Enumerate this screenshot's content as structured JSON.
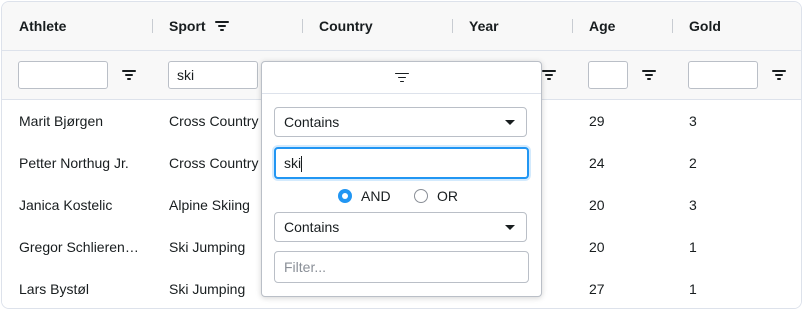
{
  "columns": [
    {
      "label": "Athlete"
    },
    {
      "label": "Sport"
    },
    {
      "label": "Country"
    },
    {
      "label": "Year"
    },
    {
      "label": "Age"
    },
    {
      "label": "Gold"
    }
  ],
  "filters": {
    "athlete": "",
    "sport": "ski",
    "age": "",
    "gold": ""
  },
  "rows": [
    {
      "athlete": "Marit Bjørgen",
      "sport": "Cross Country Skiing",
      "age": "29",
      "gold": "3"
    },
    {
      "athlete": "Petter Northug Jr.",
      "sport": "Cross Country Skiing",
      "age": "24",
      "gold": "2"
    },
    {
      "athlete": "Janica Kostelic",
      "sport": "Alpine Skiing",
      "age": "20",
      "gold": "3"
    },
    {
      "athlete": "Gregor Schlierenzauer",
      "sport": "Ski Jumping",
      "age": "20",
      "gold": "1"
    },
    {
      "athlete": "Lars Bystøl",
      "sport": "Ski Jumping",
      "age": "27",
      "gold": "1"
    }
  ],
  "popup": {
    "condition1": "Contains",
    "value1": "ski",
    "join_and": "AND",
    "join_or": "OR",
    "condition2": "Contains",
    "value2_placeholder": "Filter..."
  },
  "colors": {
    "accent": "#2196f3",
    "border": "#dde2eb",
    "header_bg": "#f8f8f8"
  }
}
